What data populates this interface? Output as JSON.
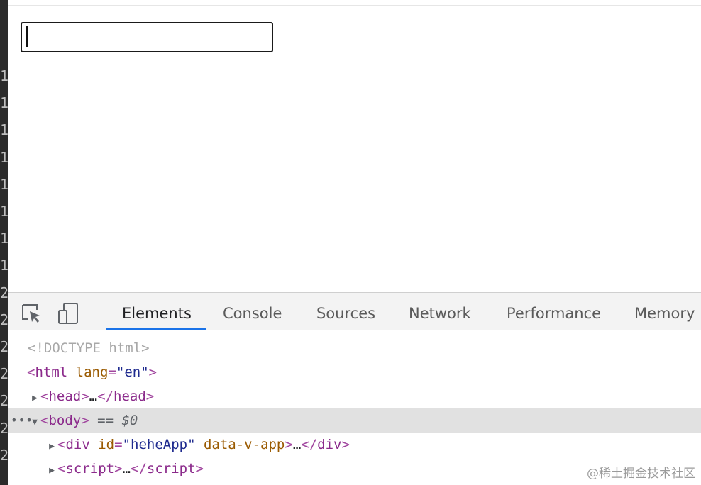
{
  "gutter": {
    "numbers": [
      "1",
      "1",
      "1",
      "1",
      "1",
      "1",
      "1",
      "1",
      "2",
      "2",
      "2",
      "2",
      "2",
      "2",
      "2"
    ]
  },
  "page": {
    "input_value": ""
  },
  "devtools": {
    "tabs": [
      {
        "label": "Elements",
        "active": true
      },
      {
        "label": "Console",
        "active": false
      },
      {
        "label": "Sources",
        "active": false
      },
      {
        "label": "Network",
        "active": false
      },
      {
        "label": "Performance",
        "active": false
      },
      {
        "label": "Memory",
        "active": false
      }
    ],
    "dom": {
      "doctype": "<!DOCTYPE html>",
      "html_open": "<",
      "html_tag": "html",
      "html_attr": "lang",
      "html_val": "\"en\"",
      "head_tag": "head",
      "ellipsis": "…",
      "body_tag": "body",
      "selected_marker": "== $0",
      "div_tag": "div",
      "div_attr_id": "id",
      "div_val_id": "\"heheApp\"",
      "div_attr2": "data-v-app",
      "script_tag": "script",
      "row_dots": "•••"
    }
  },
  "watermark": "@稀土掘金技术社区",
  "colors": {
    "active_tab_underline": "#1a73e8",
    "selected_row": "#e1e1e1",
    "gutter_bg": "#2b2b2b"
  }
}
